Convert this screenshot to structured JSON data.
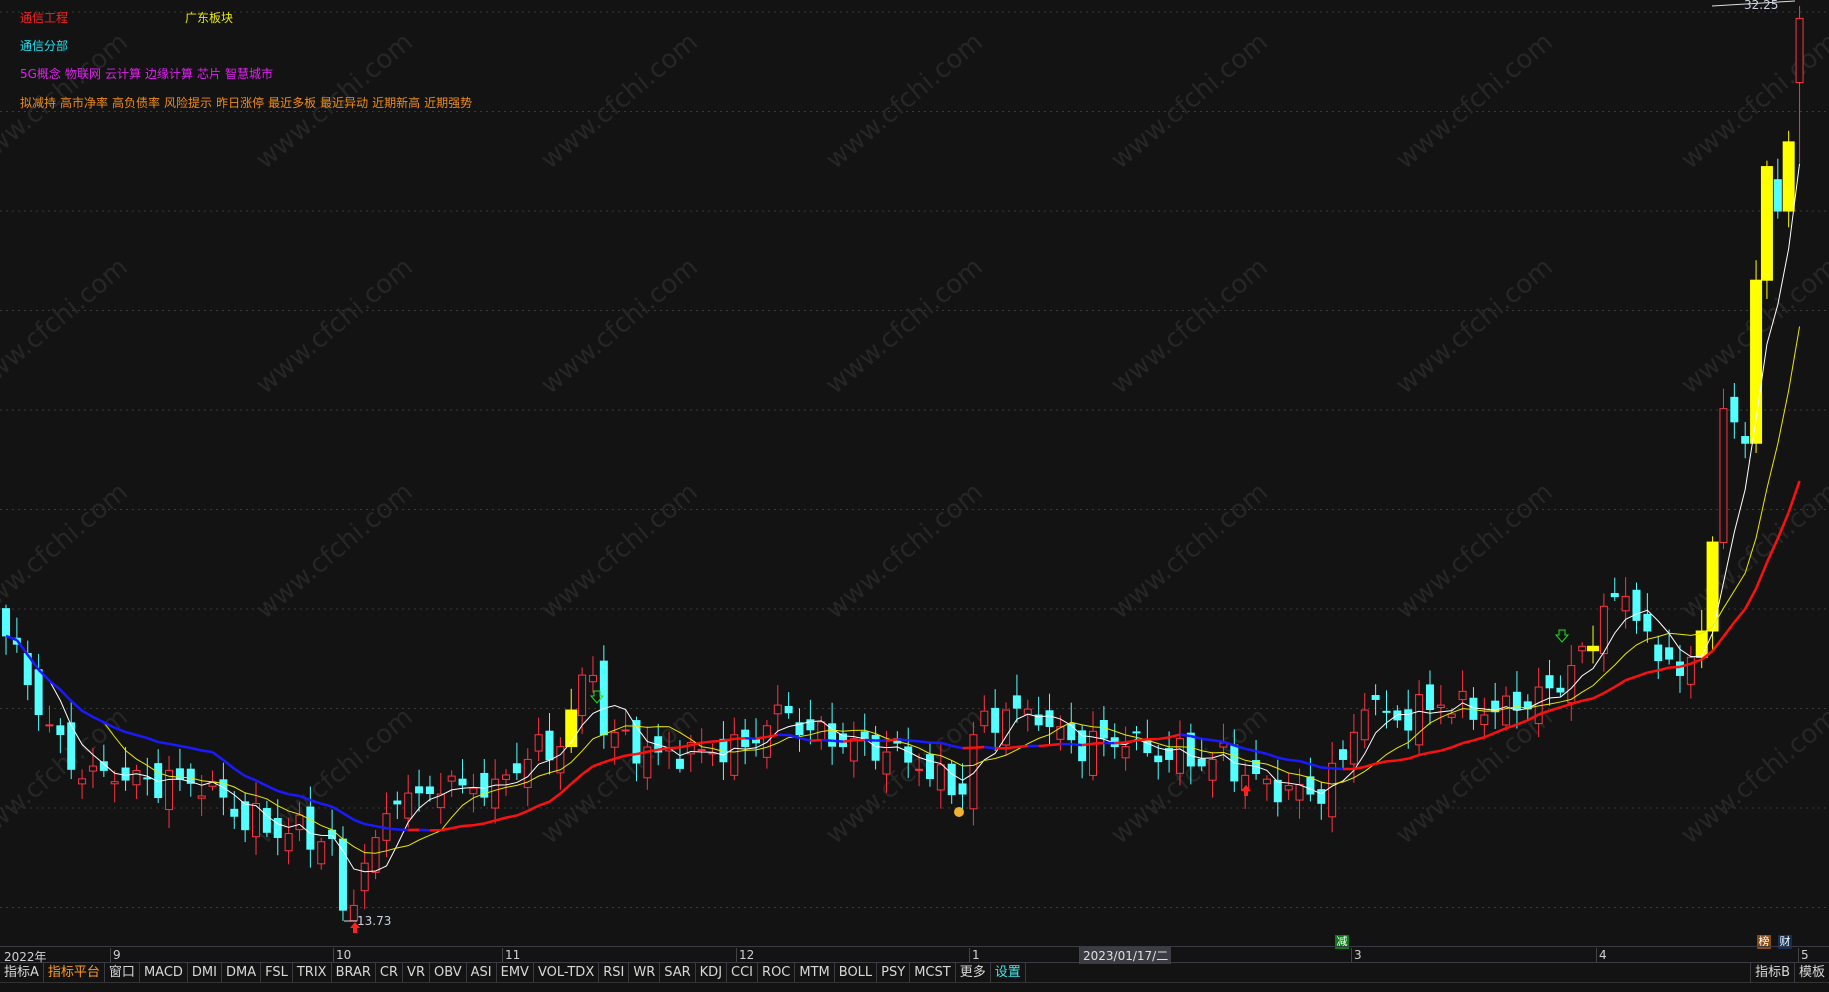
{
  "header": {
    "industry": "通信工程",
    "region": "广东板块",
    "sector": "通信分部",
    "concepts": [
      "5G概念",
      "物联网",
      "云计算",
      "边缘计算",
      "芯片",
      "智慧城市"
    ],
    "alerts": [
      "拟减持",
      "高市净率",
      "高负债率",
      "风险提示",
      "昨日涨停",
      "最近多板",
      "最近异动",
      "近期新高",
      "近期强势"
    ]
  },
  "colors": {
    "industry": "#ff2020",
    "region": "#e8e800",
    "sector": "#20e0f0",
    "concepts": "#e020f0",
    "alerts": "#f08c18",
    "up": "#ff3241",
    "down": "#54ffff",
    "limit": "#ffff00",
    "ma5": "#ffffff",
    "ma10": "#e8e800",
    "ma20_up": "#ff1010",
    "ma20_down": "#1a1aff"
  },
  "price_labels": {
    "high": "32.25",
    "low": "13.73"
  },
  "markers": {
    "reduce": "减",
    "rank": "榜",
    "finance": "财"
  },
  "chart_data": {
    "type": "candlestick",
    "y_range": [
      13.73,
      32.25
    ],
    "candle_count": 166,
    "close_keypoints": [
      [
        0,
        19.5
      ],
      [
        4,
        17.7
      ],
      [
        6,
        16.8
      ],
      [
        10,
        16.55
      ],
      [
        16,
        16.6
      ],
      [
        19,
        16.55
      ],
      [
        21,
        15.85
      ],
      [
        26,
        15.5
      ],
      [
        30,
        15.4
      ],
      [
        31,
        13.95
      ],
      [
        33,
        14.9
      ],
      [
        36,
        16.1
      ],
      [
        40,
        16.3
      ],
      [
        45,
        16.6
      ],
      [
        48,
        17.0
      ],
      [
        51,
        17.26
      ],
      [
        52,
        18.0
      ],
      [
        54,
        18.7
      ],
      [
        55,
        17.5
      ],
      [
        60,
        17.15
      ],
      [
        64,
        17.2
      ],
      [
        68,
        17.26
      ],
      [
        71,
        18.1
      ],
      [
        74,
        17.6
      ],
      [
        77,
        17.26
      ],
      [
        81,
        17.15
      ],
      [
        84,
        16.8
      ],
      [
        88,
        16.3
      ],
      [
        89,
        17.5
      ],
      [
        92,
        18.0
      ],
      [
        95,
        17.7
      ],
      [
        98,
        17.4
      ],
      [
        103,
        17.26
      ],
      [
        107,
        17.0
      ],
      [
        111,
        17.0
      ],
      [
        116,
        16.6
      ],
      [
        120,
        16.3
      ],
      [
        123,
        17.0
      ],
      [
        125,
        18.0
      ],
      [
        128,
        17.8
      ],
      [
        132,
        18.1
      ],
      [
        136,
        17.9
      ],
      [
        139,
        18.0
      ],
      [
        142,
        18.45
      ],
      [
        144,
        18.9
      ],
      [
        146,
        19.2
      ],
      [
        147,
        20.1
      ],
      [
        149,
        20.3
      ],
      [
        151,
        19.6
      ],
      [
        152,
        19.0
      ],
      [
        154,
        18.7
      ],
      [
        156,
        19.6
      ],
      [
        157,
        21.4
      ],
      [
        158,
        24.1
      ],
      [
        160,
        23.4
      ],
      [
        161,
        26.7
      ],
      [
        162,
        29.0
      ],
      [
        163,
        28.1
      ],
      [
        164,
        29.5
      ],
      [
        165,
        31.0
      ]
    ],
    "limit_up_indices": [
      52,
      146,
      156,
      157,
      161,
      162,
      164
    ],
    "moving_averages": [
      "MA5",
      "MA10",
      "MA20"
    ]
  },
  "date_axis": {
    "year": "2022年",
    "m9": "9",
    "m10": "10",
    "m11": "11",
    "m12": "12",
    "m1": "1",
    "cursor": "2023/01/17/二",
    "m3": "3",
    "m4": "4",
    "m5": "5"
  },
  "tabs": [
    "指标A",
    "指标平台",
    "窗口",
    "MACD",
    "DMI",
    "DMA",
    "FSL",
    "TRIX",
    "BRAR",
    "CR",
    "VR",
    "OBV",
    "ASI",
    "EMV",
    "VOL-TDX",
    "RSI",
    "WR",
    "SAR",
    "KDJ",
    "CCI",
    "ROC",
    "MTM",
    "BOLL",
    "PSY",
    "MCST",
    "更多",
    "设置"
  ],
  "tabs_right": [
    "指标B",
    "模板"
  ],
  "watermark": "www.cfchi.com"
}
